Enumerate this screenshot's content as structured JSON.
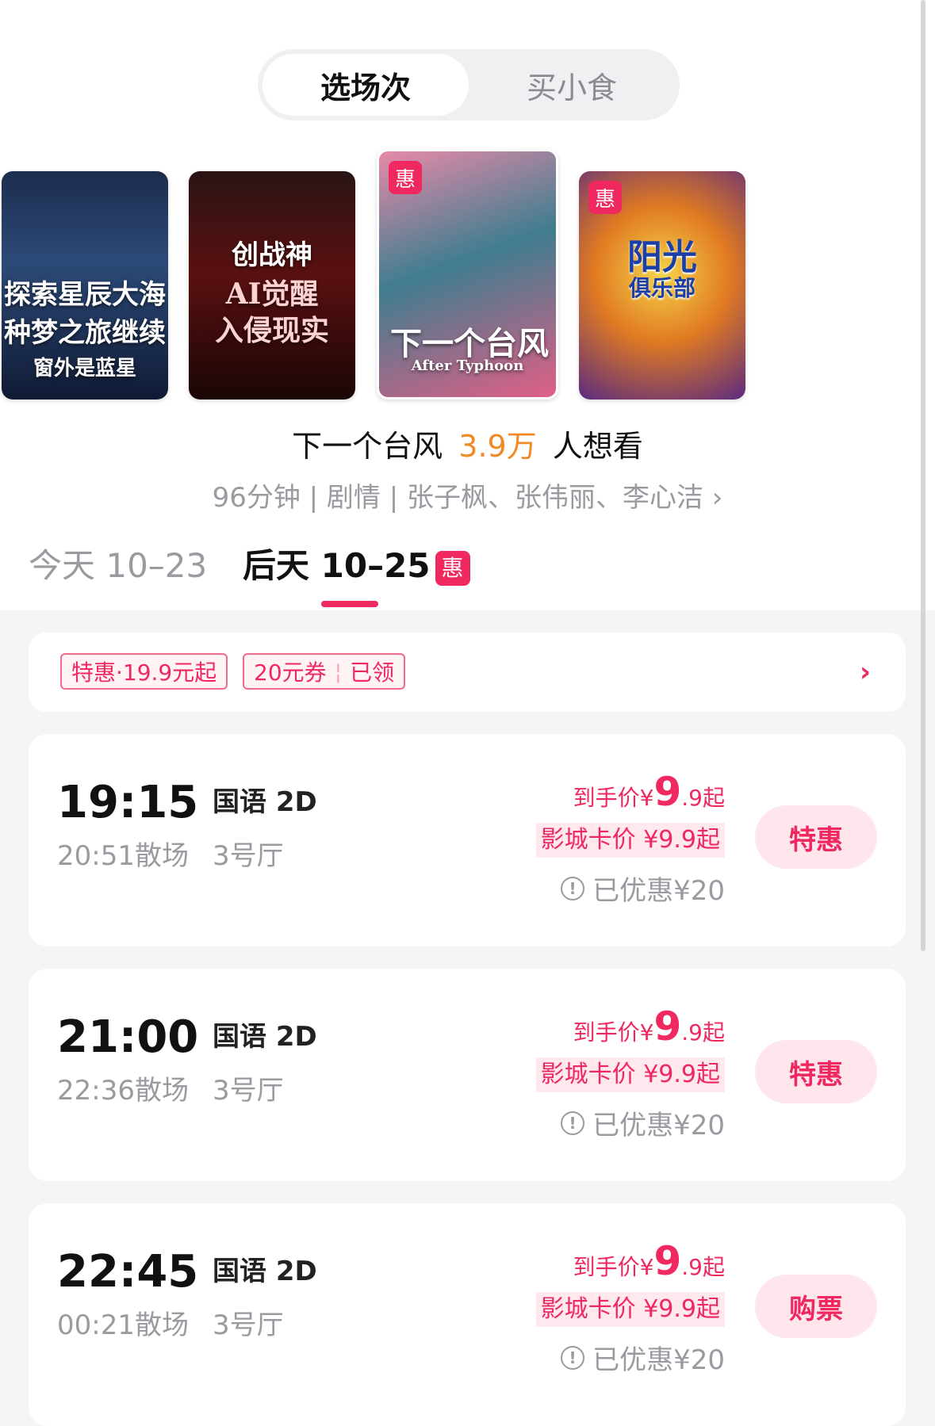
{
  "tabs": [
    "选场次",
    "买小食"
  ],
  "posters": [
    {
      "line1": "探索星辰大海",
      "line2": "种梦之旅继续",
      "line3": "窗外是蓝星",
      "badge": ""
    },
    {
      "line1": "创战神",
      "line2": "AI觉醒",
      "line3": "入侵现实",
      "badge": ""
    },
    {
      "line1": "下一个台风",
      "line2": "After Typhoon",
      "line3": "",
      "badge": "惠"
    },
    {
      "line1": "阳光",
      "line2": "俱乐部",
      "line3": "",
      "badge": "惠"
    }
  ],
  "movie": {
    "title": "下一个台风",
    "want_count": "3.9万",
    "want_suffix": "人想看",
    "meta": "96分钟 | 剧情 | 张子枫、张伟丽、李心洁 ›"
  },
  "dates": {
    "today": "今天 10–23",
    "after": "后天 10–25",
    "badge": "惠"
  },
  "promo": {
    "tag1": "特惠·19.9元起",
    "tag2_a": "20元券",
    "tag2_b": "已领",
    "arrow": "›"
  },
  "showtimes": [
    {
      "start": "19:15",
      "end": "20:51散场",
      "lang": "国语 2D",
      "hall": "3号厅",
      "price_prefix": "到手价¥",
      "price_big": "9",
      "price_rest": ".9起",
      "card_price": "影城卡价 ¥9.9起",
      "discount": "已优惠¥20",
      "button": "特惠"
    },
    {
      "start": "21:00",
      "end": "22:36散场",
      "lang": "国语 2D",
      "hall": "3号厅",
      "price_prefix": "到手价¥",
      "price_big": "9",
      "price_rest": ".9起",
      "card_price": "影城卡价 ¥9.9起",
      "discount": "已优惠¥20",
      "button": "特惠"
    },
    {
      "start": "22:45",
      "end": "00:21散场",
      "lang": "国语 2D",
      "hall": "3号厅",
      "price_prefix": "到手价¥",
      "price_big": "9",
      "price_rest": ".9起",
      "card_price": "影城卡价 ¥9.9起",
      "discount": "已优惠¥20",
      "button": "购票"
    }
  ],
  "colors": {
    "accent": "#f02860",
    "want": "#f08a24",
    "muted": "#9a9aa0"
  }
}
